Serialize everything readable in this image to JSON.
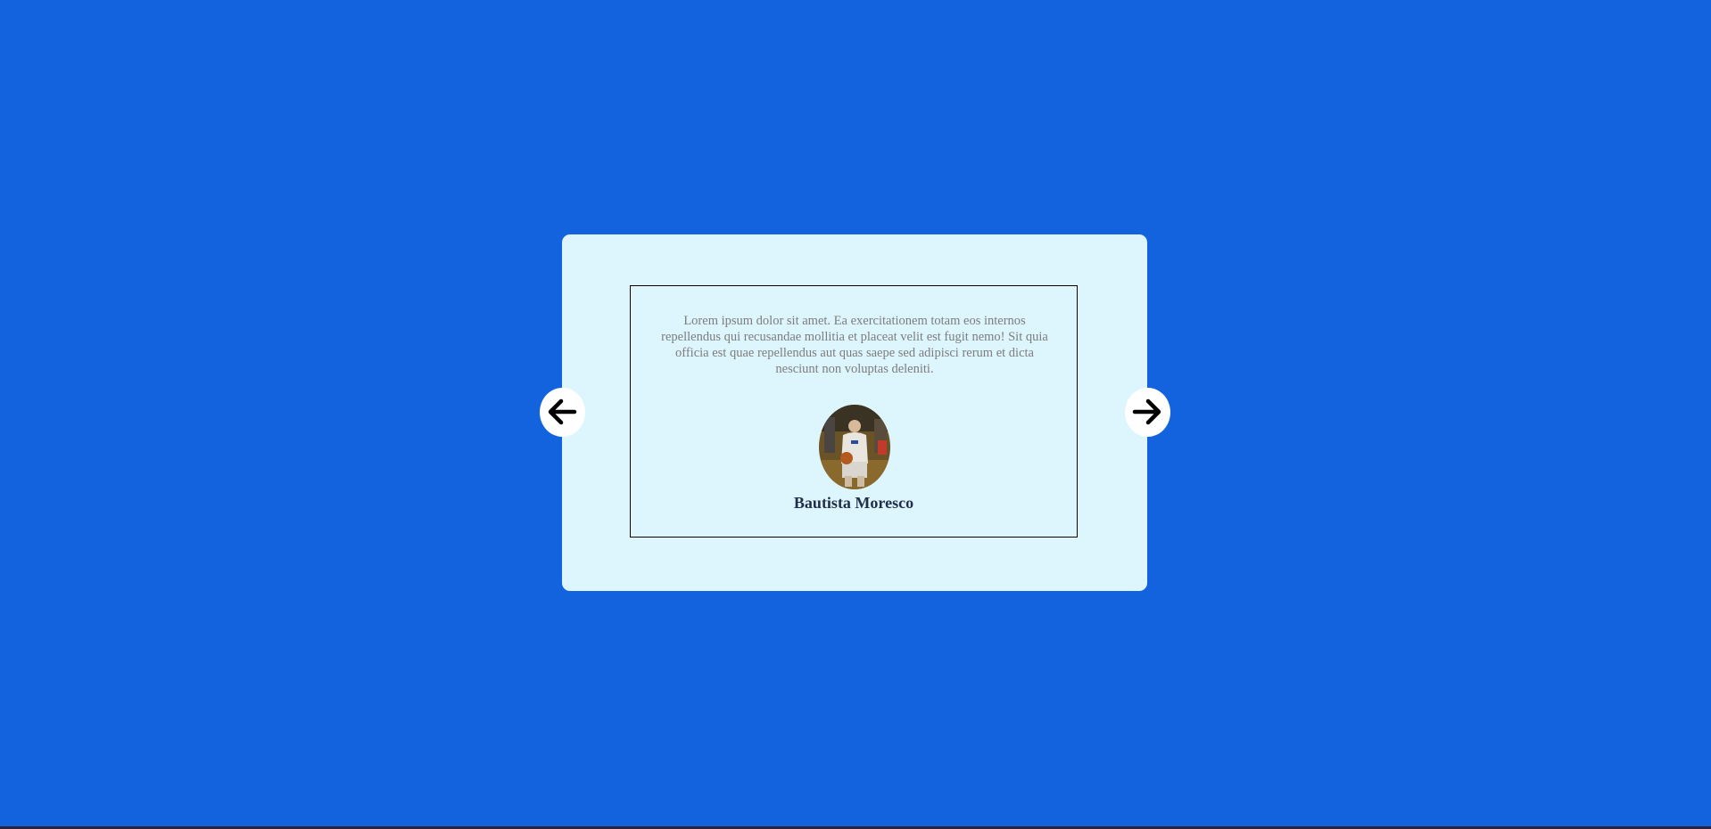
{
  "testimonial": {
    "quote": "Lorem ipsum dolor sit amet. Ea exercitationem totam eos internos repellendus qui recusandae mollitia et placeat velit est fugit nemo! Sit quia officia est quae repellendus aut quas saepe sed adipisci rerum et dicta nesciunt non voluptas deleniti.",
    "name": "Bautista Moresco"
  },
  "navigation": {
    "prev_icon": "arrow-left-icon",
    "next_icon": "arrow-right-icon"
  },
  "colors": {
    "background": "#1463de",
    "card": "#ddf5fd",
    "quote_text": "#7d7d7d",
    "name_text": "#1f2f4a"
  }
}
